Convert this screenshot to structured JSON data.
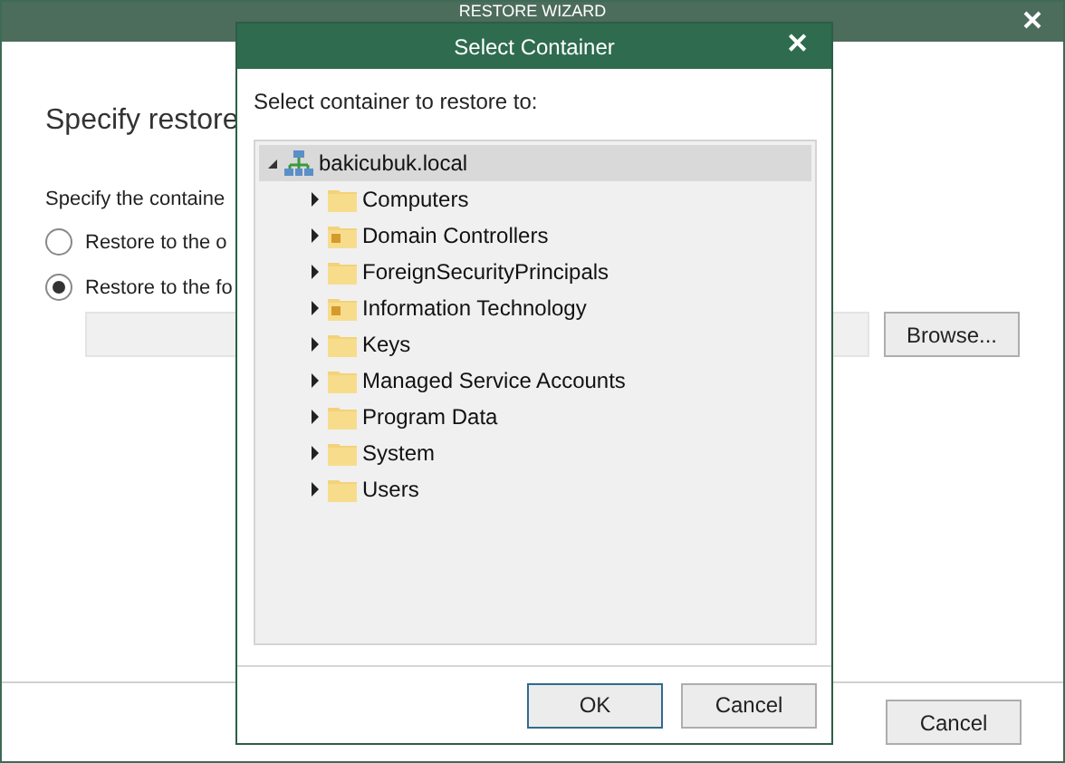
{
  "wizard": {
    "title": "RESTORE WIZARD",
    "heading": "Specify restore",
    "prompt": "Specify the containe",
    "options": [
      {
        "label": "Restore to the o",
        "selected": false
      },
      {
        "label": "Restore to the fo",
        "selected": true
      }
    ],
    "browse_button": "Browse...",
    "cancel_button": "Cancel"
  },
  "dialog": {
    "title": "Select Container",
    "close": "✕",
    "prompt": "Select container to restore to:",
    "tree": [
      {
        "label": "bakicubuk.local",
        "kind": "domain",
        "expanded": true,
        "selected": true,
        "children": [
          {
            "label": "Computers",
            "kind": "folder",
            "expanded": false,
            "selected": false
          },
          {
            "label": "Domain Controllers",
            "kind": "ou",
            "expanded": false,
            "selected": false
          },
          {
            "label": "ForeignSecurityPrincipals",
            "kind": "folder",
            "expanded": false,
            "selected": false
          },
          {
            "label": "Information Technology",
            "kind": "ou",
            "expanded": false,
            "selected": false
          },
          {
            "label": "Keys",
            "kind": "folder",
            "expanded": false,
            "selected": false
          },
          {
            "label": "Managed Service Accounts",
            "kind": "folder",
            "expanded": false,
            "selected": false
          },
          {
            "label": "Program Data",
            "kind": "folder",
            "expanded": false,
            "selected": false
          },
          {
            "label": "System",
            "kind": "folder",
            "expanded": false,
            "selected": false
          },
          {
            "label": "Users",
            "kind": "folder",
            "expanded": false,
            "selected": false
          }
        ]
      }
    ],
    "buttons": [
      "OK",
      "Cancel"
    ]
  }
}
